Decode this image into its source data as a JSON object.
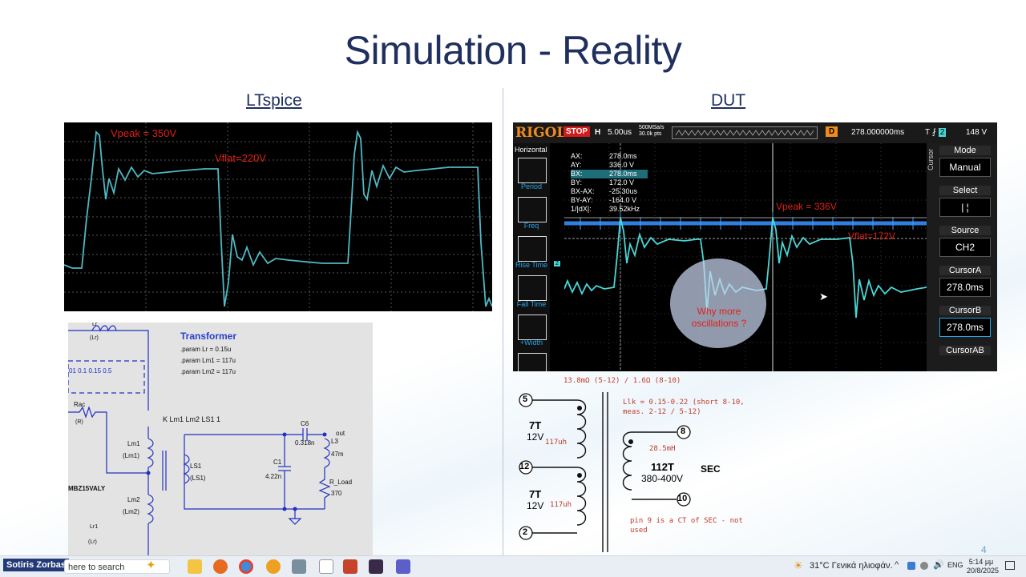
{
  "slide": {
    "title": "Simulation - Reality",
    "left_heading": "LTspice",
    "right_heading": "DUT",
    "page_number": "4"
  },
  "ltspice": {
    "vpeak_label": "Vpeak = 350V",
    "vflat_label": "Vflat=220V",
    "trace_color": "#4fb8c4"
  },
  "schematic": {
    "title": "Transformer",
    "params": [
      ".param Lr = 0.15u",
      ".param Lm1 = 117u",
      ".param Lm2 = 117u"
    ],
    "sweep": "01 0.1 0.15  0.5",
    "coupling": "K Lm1 Lm2 LS1  1",
    "lr": "Lr",
    "lr_val": "(Lr)",
    "rac": "Rac",
    "rac_val": "(R)",
    "lm1": "Lm1",
    "lm1_val": "(Lm1)",
    "lm2": "Lm2",
    "lm2_val": "(Lm2)",
    "lr1": "Lr1",
    "lr1_val": "(Lr)",
    "ls1": "LS1",
    "ls1_val": "(LS1)",
    "device": "MBZ15VALY",
    "c6": "C6",
    "c6_val": "0.318n",
    "out": "out",
    "c1": "C1",
    "c1_val": "4.22n",
    "l3": "L3",
    "l3_val": "47m",
    "rload": "R_Load",
    "rload_val": "370"
  },
  "scope": {
    "brand": "RIGOL",
    "state": "STOP",
    "timebase_label": "H",
    "timebase": "5.00us",
    "sample_rate": "500MSa/s",
    "points": "30.0k pts",
    "delay_label": "D",
    "delay": "278.000000ms",
    "trigger": "148 V",
    "left_menu_title": "Horizontal",
    "left_menu": [
      "Period",
      "Freq",
      "Rise Time",
      "Fall Time",
      "+Width"
    ],
    "readouts": [
      {
        "k": "AX:",
        "v": "278.0ms"
      },
      {
        "k": "AY:",
        "v": "336.0 V"
      },
      {
        "k": "BX:",
        "v": "278.0ms"
      },
      {
        "k": "BY:",
        "v": "172.0 V"
      },
      {
        "k": "BX-AX:",
        "v": "-25.30us"
      },
      {
        "k": "BY-AY:",
        "v": "-164.0 V"
      },
      {
        "k": "1/|dX|:",
        "v": "39.52kHz"
      }
    ],
    "vpeak_label": "Vpeak = 336V",
    "vflat_label": "Vflat=172V",
    "bubble_line1": "Why more",
    "bubble_line2": "oscillations ?",
    "cursor_side": "Cursor",
    "right_menu": [
      {
        "title": "Mode",
        "value": "Manual"
      },
      {
        "title": "Select",
        "value": "| ¦"
      },
      {
        "title": "Source",
        "value": "CH2"
      },
      {
        "title": "CursorA",
        "value": "278.0ms"
      },
      {
        "title": "CursorB",
        "value": "278.0ms"
      },
      {
        "title": "CursorAB",
        "value": ""
      }
    ],
    "ch1_color": "#2f7fe0",
    "ch2_color": "#4ad6d6"
  },
  "transformer": {
    "resistance": "13.8mΩ (5-12) / 1.6Ω (8-10)",
    "llk_line1": "Llk = 0.15-0.22 (short 8-10,",
    "llk_line2": "meas. 2-12 / 5-12)",
    "pin5": "5",
    "pin12": "12",
    "pin2": "2",
    "pin8": "8",
    "pin10": "10",
    "w1_turns": "7T",
    "w1_volt": "12V",
    "w1_ind": "117uh",
    "w2_turns": "7T",
    "w2_volt": "12V",
    "w2_ind": "117uh",
    "sec_ind": "28.5mH",
    "sec_turns": "112T",
    "sec_volt": "380-400V",
    "sec_label": "SEC",
    "note_line1": "pin 9 is a CT of SEC - not",
    "note_line2": "used"
  },
  "taskbar": {
    "user": "Sotiris Zorbas",
    "search_placeholder": "here to search",
    "weather": "31°C  Γενικά ηλιοφάν.",
    "lang": "ENG",
    "time": "5:14 μμ",
    "date": "20/8/2025"
  }
}
